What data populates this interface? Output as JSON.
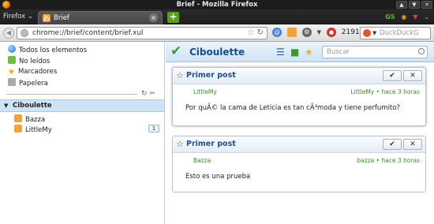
{
  "window": {
    "title": "Brief - Mozilla Firefox"
  },
  "tabbar": {
    "firefox_menu": "Firefox",
    "tab_label": "Brief",
    "new_tab": "+",
    "ext_labels": [
      "GS"
    ]
  },
  "navbar": {
    "url": "chrome://brief/content/brief.xul",
    "count": "2191",
    "search_placeholder": "DuckDuckG"
  },
  "sidebar": {
    "items": [
      {
        "label": "Todos los elementos",
        "icon": "globe-icon"
      },
      {
        "label": "No leídos",
        "icon": "unread-icon"
      },
      {
        "label": "Marcadores",
        "icon": "star-icon"
      },
      {
        "label": "Papelera",
        "icon": "trash-icon"
      }
    ],
    "folder": {
      "label": "Ciboulette",
      "expanded": true
    },
    "feeds": [
      {
        "label": "Bazza",
        "unread": ""
      },
      {
        "label": "LittleMy",
        "unread": "1"
      }
    ]
  },
  "main": {
    "title": "Ciboulette",
    "search_placeholder": "Buscar",
    "entries": [
      {
        "title": "Primer post",
        "feed": "LittleMy",
        "meta": "LittleMy • hace 3 horas",
        "body": "Por quÃ© la cama de Leticia es tan cÃ³moda y tiene perfumito?",
        "selected": true
      },
      {
        "title": "Primer post",
        "feed": "Bazza",
        "meta": "bazza • hace 3 horas",
        "body": "Esto es una prueba",
        "selected": false
      }
    ]
  },
  "colors": {
    "header_accent": "#174d92",
    "feed_green": "#3a8f2a",
    "folder_highlight": "#cfe3f7"
  }
}
